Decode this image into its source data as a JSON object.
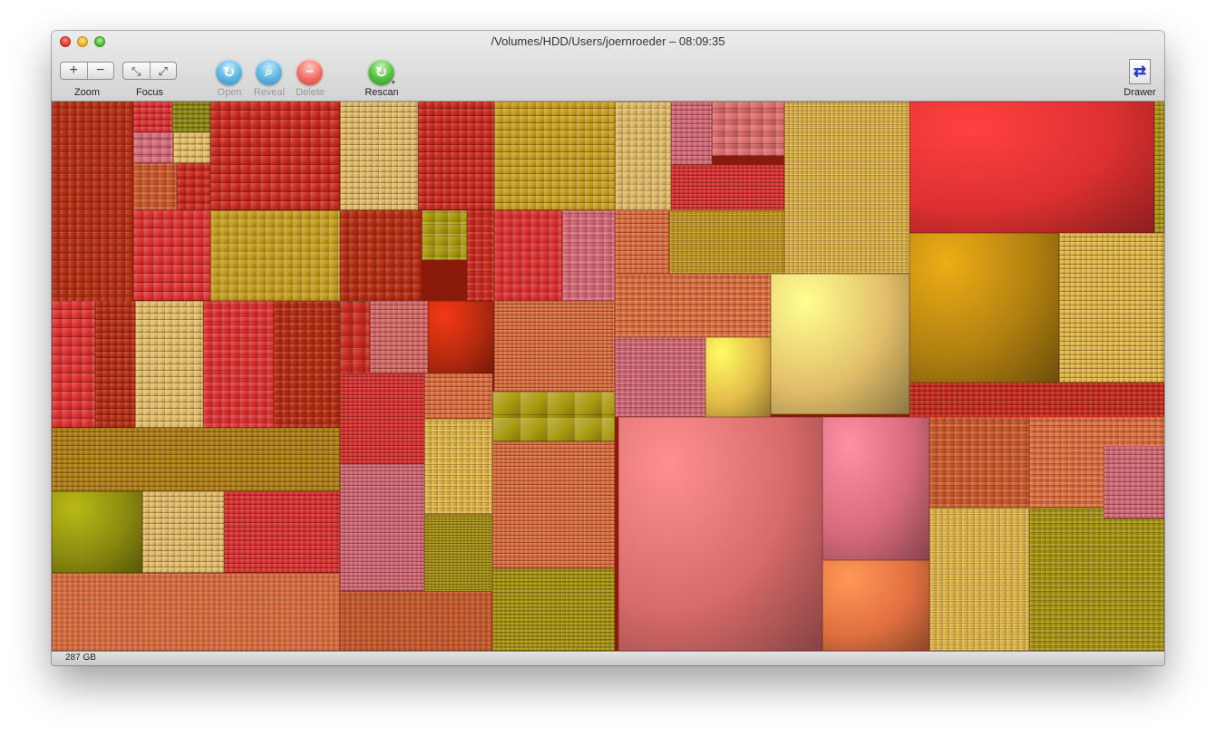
{
  "window": {
    "title": "/Volumes/HDD/Users/joernroeder – 08:09:35"
  },
  "toolbar": {
    "zoom": {
      "label": "Zoom",
      "in_glyph": "+",
      "out_glyph": "−"
    },
    "focus": {
      "label": "Focus",
      "in_glyph": "⤡",
      "out_glyph": "⤢"
    },
    "open": {
      "label": "Open",
      "glyph": "↻",
      "icon": "open-icon"
    },
    "reveal": {
      "label": "Reveal",
      "glyph": "⌕",
      "icon": "magnifier-icon"
    },
    "delete": {
      "label": "Delete",
      "glyph": "−",
      "icon": "delete-icon"
    },
    "rescan": {
      "label": "Rescan",
      "glyph": "↻",
      "caret": "▾",
      "icon": "rescan-icon"
    },
    "drawer": {
      "label": "Drawer",
      "glyph": "⇄",
      "icon": "drawer-icon"
    }
  },
  "statusbar": {
    "total_size": "287 GB"
  },
  "palette": [
    "#b52a0f",
    "#c9281c",
    "#d2a24b",
    "#e2bf6a",
    "#cc5a2b",
    "#a99a10",
    "#d66a7a",
    "#dd3030",
    "#c8a020",
    "#8a8a10",
    "#d86a6a",
    "#b08010",
    "#e07040",
    "#e3bb4a"
  ]
}
